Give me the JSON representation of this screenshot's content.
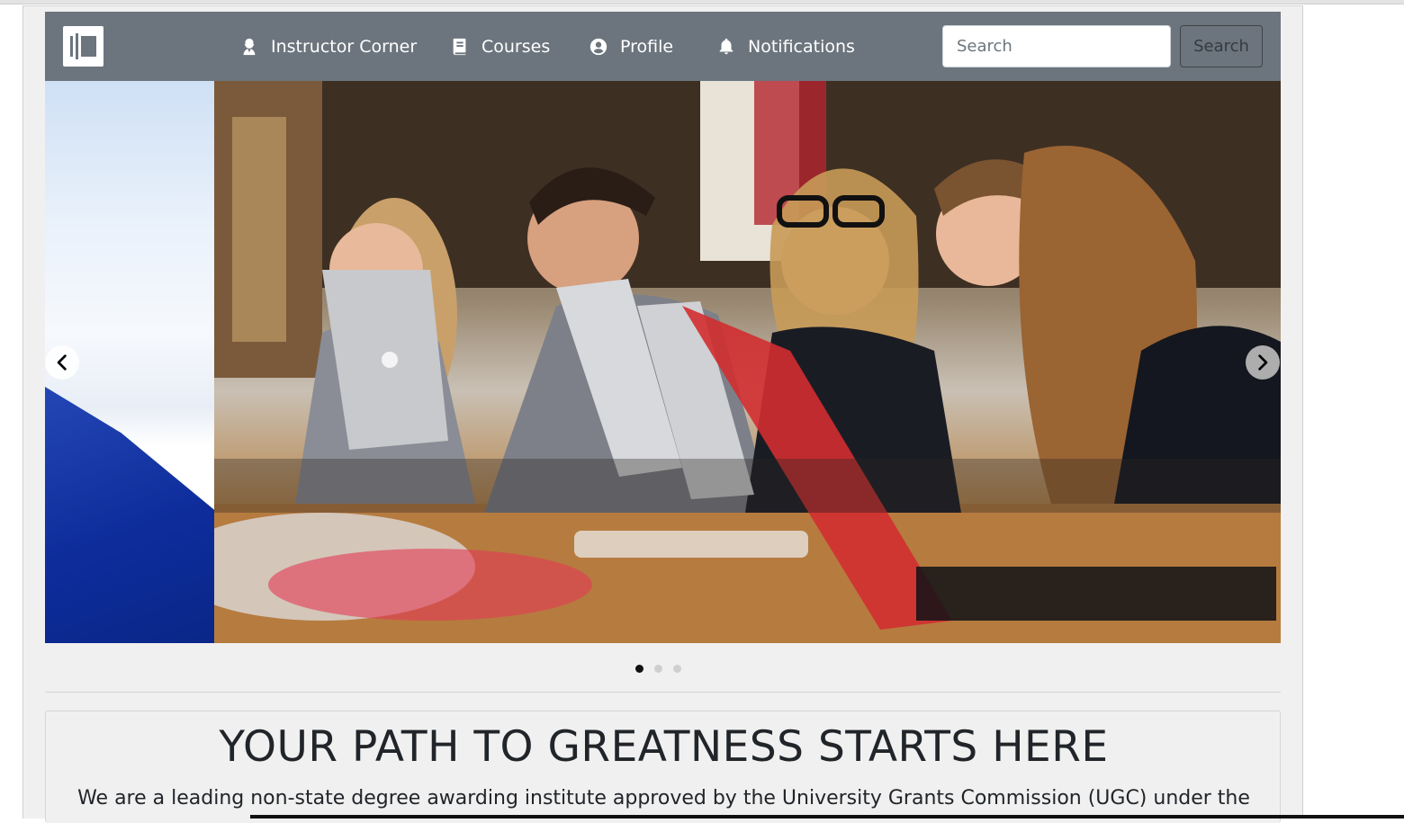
{
  "navbar": {
    "logo_icon": "brand-logo-icon",
    "links": [
      {
        "label": "Instructor Corner",
        "icon": "user-tie-icon"
      },
      {
        "label": "Courses",
        "icon": "book-icon"
      },
      {
        "label": "Profile",
        "icon": "user-circle-icon"
      },
      {
        "label": "Notifications",
        "icon": "bell-icon"
      }
    ],
    "search": {
      "placeholder": "Search",
      "value": "",
      "button_label": "Search"
    }
  },
  "carousel": {
    "active_slide": 1,
    "slide_count": 3,
    "prev_icon": "chevron-left-icon",
    "next_icon": "chevron-right-icon"
  },
  "hero": {
    "title": "YOUR PATH TO GREATNESS STARTS HERE",
    "text": "We are a leading non-state degree awarding institute approved by the University Grants Commission (UGC) under the"
  },
  "colors": {
    "navbar_bg": "#6c757d",
    "page_bg": "#f0f0f0",
    "text": "#212529"
  }
}
